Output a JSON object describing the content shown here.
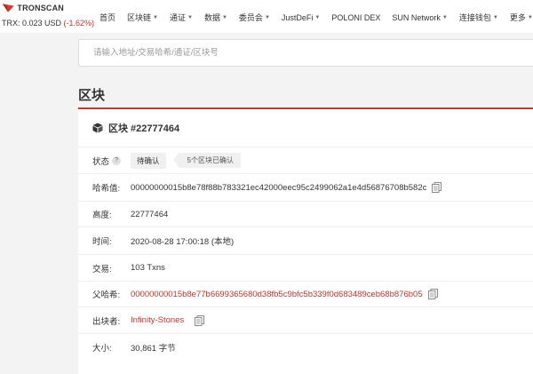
{
  "header": {
    "logo_text": "TRONSCAN",
    "price_prefix": "TRX: 0.023 USD",
    "price_change": "(-1.62%)",
    "nav": [
      {
        "label": "首页"
      },
      {
        "label": "区块链",
        "dropdown": true
      },
      {
        "label": "通证",
        "dropdown": true
      },
      {
        "label": "数据",
        "dropdown": true
      },
      {
        "label": "委员会",
        "dropdown": true
      },
      {
        "label": "JustDeFi",
        "dropdown": true
      },
      {
        "label": "POLONI DEX"
      },
      {
        "label": "SUN Network",
        "dropdown": true
      },
      {
        "label": "连接钱包",
        "dropdown": true
      },
      {
        "label": "更多",
        "dropdown": true
      }
    ],
    "colors": {
      "accent": "#c23631"
    }
  },
  "search": {
    "placeholder": "请输入地址/交易哈希/通证/区块号",
    "value": ""
  },
  "page_title": "区块",
  "block": {
    "title": "区块 #22777464",
    "fields": {
      "status_label": "状态",
      "status_help_icon": "?",
      "status_pending": "待确认",
      "status_confirmations": "5个区块已确认",
      "hash_label": "哈希值:",
      "hash_value": "00000000015b8e78f88b783321ec42000eec95c2499062a1e4d56876708b582c",
      "height_label": "高度:",
      "height_value": "22777464",
      "time_label": "时间:",
      "time_value": "2020-08-28 17:00:18 (本地)",
      "tx_label": "交易:",
      "tx_value": "103 Txns",
      "parent_label": "父哈希:",
      "parent_value": "00000000015b8e77b6699365680d38fb5c9bfc5b339f0d683489ceb68b876b05",
      "producer_label": "出块者:",
      "producer_value": "Infinity-Stones",
      "size_label": "大小:",
      "size_value": "30,861 字节"
    }
  },
  "icons": {
    "logo": "tronscan-logo-icon",
    "cube": "cube-icon",
    "copy": "copy-icon",
    "help": "help-icon",
    "caret": "chevron-down-icon"
  }
}
